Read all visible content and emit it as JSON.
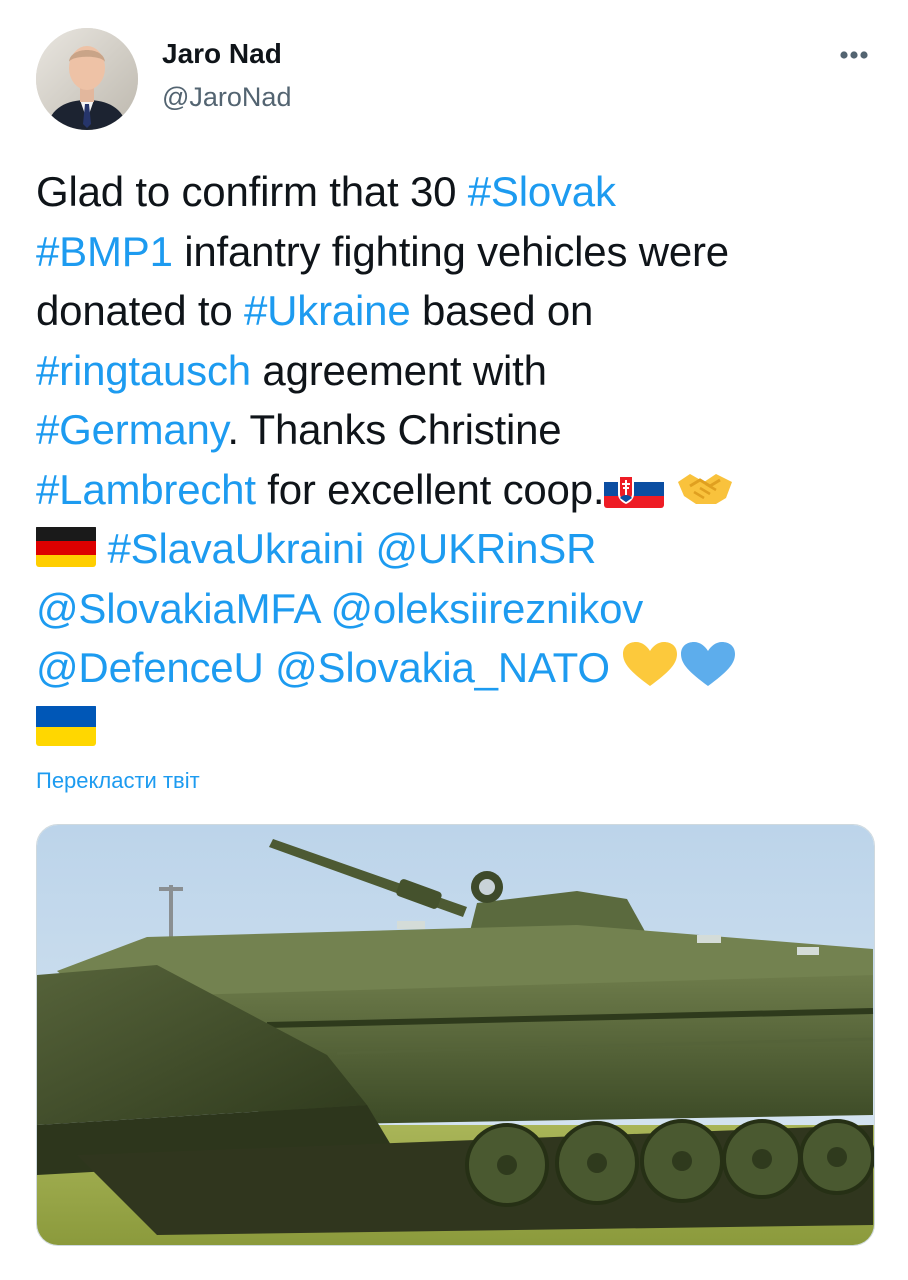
{
  "author": {
    "display_name": "Jaro Nad",
    "handle": "@JaroNad",
    "avatar_icon": "person-avatar"
  },
  "menu": {
    "more_icon": "ellipsis-icon",
    "label": "•••"
  },
  "tweet": {
    "line1": {
      "t1": "Glad to confirm that 30 ",
      "tag1": "#Slovak"
    },
    "line2": {
      "tag1": "#BMP1",
      "t1": " infantry fighting vehicles were"
    },
    "line3": {
      "t1": "donated to ",
      "tag1": "#Ukraine",
      "t2": " based on"
    },
    "line4": {
      "tag1": "#ringtausch",
      "t1": " agreement with"
    },
    "line5": {
      "tag1": "#Germany",
      "t1": ". Thanks Christine"
    },
    "line6": {
      "tag1": "#Lambrecht",
      "t1": " for excellent coop."
    },
    "line7": {
      "tag1": "#SlavaUkraini",
      "tag2": "@UKRinSR"
    },
    "line8": {
      "tag1": "@SlovakiaMFA",
      "tag2": "@oleksiireznikov"
    },
    "line9": {
      "tag1": "@DefenceU",
      "tag2": "@Slovakia_NATO"
    },
    "emojis": [
      "slovakia-flag",
      "handshake",
      "germany-flag",
      "yellow-heart",
      "blue-heart",
      "ukraine-flag"
    ]
  },
  "translate_label": "Перекласти твіт",
  "media": {
    "kind": "photo",
    "subject_icon": "armored-vehicle-photo"
  },
  "colors": {
    "link": "#1d9bf0",
    "text": "#0f1419",
    "secondary": "#536471"
  }
}
